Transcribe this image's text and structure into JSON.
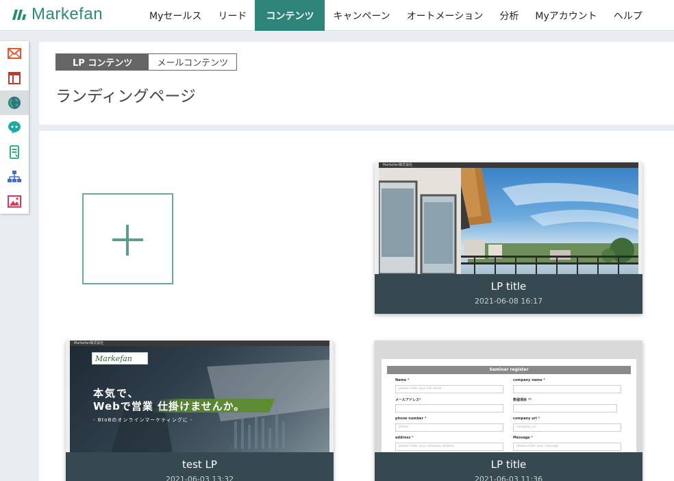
{
  "app": {
    "logo_text": "Markefan",
    "brand_color": "#2d8478"
  },
  "nav": {
    "items": [
      {
        "label": "Myセールス"
      },
      {
        "label": "リード"
      },
      {
        "label": "コンテンツ",
        "active": true
      },
      {
        "label": "キャンペーン"
      },
      {
        "label": "オートメーション"
      },
      {
        "label": "分析"
      },
      {
        "label": "Myアカウント"
      },
      {
        "label": "ヘルプ"
      }
    ]
  },
  "sidebar": {
    "items": [
      {
        "icon": "mail-icon"
      },
      {
        "icon": "layout-icon"
      },
      {
        "icon": "globe-icon",
        "active": true
      },
      {
        "icon": "chat-icon"
      },
      {
        "icon": "mobile-form-icon"
      },
      {
        "icon": "sitemap-icon"
      },
      {
        "icon": "image-icon"
      }
    ]
  },
  "content_tabs": [
    {
      "label": "LP コンテンツ",
      "active": true
    },
    {
      "label": "メールコンテンツ",
      "active": false
    }
  ],
  "page_title": "ランディングページ",
  "add_card": {
    "icon": "plus-icon"
  },
  "lp_cards": [
    {
      "title": "LP title",
      "date": "2021-06-08 16:17",
      "thumb_header": "Markefan株式会社"
    },
    {
      "title": "test LP",
      "date": "2021-06-03 13:32",
      "thumb_header": "Markefan株式会社",
      "hero": {
        "logo": "Markefan",
        "line1": "本気で、",
        "line2": "Webで営業 仕掛けませんか。",
        "line3": "- BtoBのオンラインマーケティングに -"
      }
    },
    {
      "title": "LP title",
      "date": "2021-06-03 11:36",
      "form": {
        "heading": "Seminar register",
        "fields": [
          {
            "label": "Name",
            "placeholder": "please enter your full name"
          },
          {
            "label": "company name",
            "placeholder": ""
          },
          {
            "label": "メールアドレス",
            "placeholder": ""
          },
          {
            "label": "数値項目",
            "placeholder": ""
          },
          {
            "label": "phone number",
            "placeholder": "phone"
          },
          {
            "label": "company url",
            "placeholder": "company_url"
          },
          {
            "label": "address",
            "placeholder": "please enter your company address"
          },
          {
            "label": "Message",
            "placeholder": "please enter your message"
          }
        ]
      }
    }
  ]
}
